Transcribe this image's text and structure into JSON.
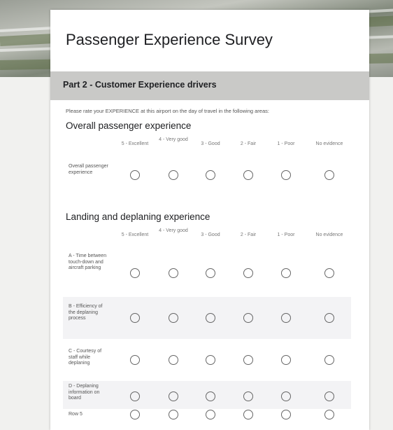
{
  "survey": {
    "title": "Passenger Experience Survey",
    "section_title": "Part 2 - Customer Experience drivers",
    "intro": "Please rate your EXPERIENCE at this airport on the day of travel in the following areas:"
  },
  "columns": [
    "5 - Excellent",
    "4 - Very good",
    "3 - Good",
    "2 - Fair",
    "1 - Poor",
    "No evidence"
  ],
  "questions": [
    {
      "title": "Overall passenger experience",
      "rows": [
        {
          "label": "Overall passenger experience"
        }
      ]
    },
    {
      "title": "Landing and deplaning experience",
      "rows": [
        {
          "label": "A - Time between touch-down and aircraft parking"
        },
        {
          "label": "B - Efficiency of the deplaning process"
        },
        {
          "label": "C - Courtesy of staff while deplaning"
        },
        {
          "label": "D - Deplaning information on board"
        },
        {
          "label": "Row 5"
        }
      ]
    }
  ],
  "colors": {
    "section_bar": "#c9c9c7",
    "card": "#ffffff",
    "radio_border": "#666666"
  }
}
